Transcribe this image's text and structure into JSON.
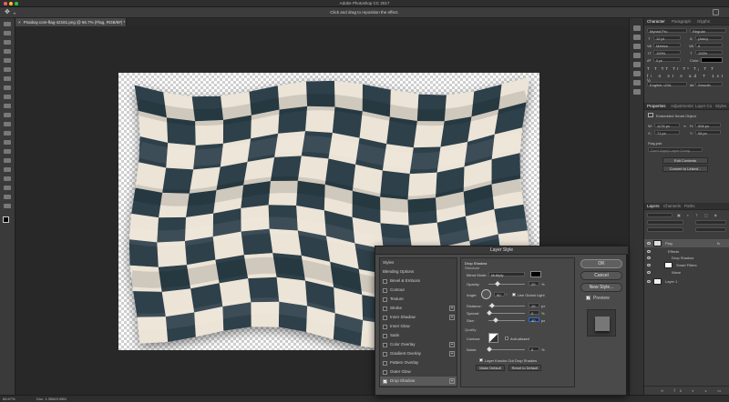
{
  "app": {
    "title": "Adobe Photoshop CC 2017"
  },
  "options_bar": {
    "hint": "Click and drag to reposition the effect."
  },
  "document": {
    "tab_label": "Pixabay.com-flag-42181.png @ 66.7% (Flag, RGB/8#) *",
    "tab_close": "×"
  },
  "status": {
    "zoom": "66.67%",
    "doc_info": "Doc: 1.35M/4.95M"
  },
  "colors": {
    "accent": "#2d6fd6",
    "flag_dark": "#2d3f4a",
    "flag_light": "#ece4d6"
  },
  "character_panel": {
    "tabs": [
      "Character",
      "Paragraph",
      "Glyphs"
    ],
    "font": "Myriad Pro",
    "font_style": "Regular",
    "size": "12 pt",
    "leading": "(Auto)",
    "kerning": "Metrics",
    "tracking": "0",
    "vscale": "100%",
    "hscale": "100%",
    "baseline": "0 pt",
    "color_label": "Color:",
    "language": "English: USA",
    "aa_label": "aa",
    "aa_value": "Smooth"
  },
  "properties_panel": {
    "tabs": [
      "Properties",
      "Adjustments",
      "Layer Co",
      "Styles"
    ],
    "title": "Embedded Smart Object",
    "w_label": "W:",
    "w": "1176 px",
    "h_label": "H:",
    "h": "906 px",
    "x_label": "X:",
    "x": "71 px",
    "y_label": "Y:",
    "y": "58 px",
    "path_label": "Flag.psb",
    "comp_placeholder": "Don't Apply Layer Comp",
    "edit_button": "Edit Contents",
    "convert_button": "Convert to Linked..."
  },
  "layers_panel": {
    "tabs": [
      "Layers",
      "Channels",
      "Paths"
    ],
    "layers": [
      {
        "name": "Flag",
        "fx": "fx"
      },
      {
        "name": "Effects"
      },
      {
        "name": "Drop Shadow"
      },
      {
        "name": "Smart Filters"
      },
      {
        "name": "Wave"
      },
      {
        "name": "Layer 1"
      }
    ]
  },
  "layer_style": {
    "title": "Layer Style",
    "styles_header": "Styles",
    "items": [
      {
        "label": "Blending Options",
        "check": false,
        "plus": false
      },
      {
        "label": "Bevel & Emboss",
        "check": true,
        "plus": false
      },
      {
        "label": "Contour",
        "check": true,
        "plus": false
      },
      {
        "label": "Texture",
        "check": true,
        "plus": false
      },
      {
        "label": "Stroke",
        "check": true,
        "plus": true
      },
      {
        "label": "Inner Shadow",
        "check": true,
        "plus": true
      },
      {
        "label": "Inner Glow",
        "check": true,
        "plus": false
      },
      {
        "label": "Satin",
        "check": true,
        "plus": false
      },
      {
        "label": "Color Overlay",
        "check": true,
        "plus": true
      },
      {
        "label": "Gradient Overlay",
        "check": true,
        "plus": true
      },
      {
        "label": "Pattern Overlay",
        "check": true,
        "plus": false
      },
      {
        "label": "Outer Glow",
        "check": true,
        "plus": false
      },
      {
        "label": "Drop Shadow",
        "check": true,
        "plus": true
      }
    ],
    "footer_fx": "fx",
    "drop_shadow": {
      "header": "Drop Shadow",
      "structure": "Structure",
      "blend_mode_label": "Blend Mode:",
      "blend_mode": "Multiply",
      "opacity_label": "Opacity:",
      "opacity": "20",
      "angle_label": "Angle:",
      "angle": "90",
      "global_light": "Use Global Light",
      "distance_label": "Distance:",
      "distance": "10",
      "spread_label": "Spread:",
      "spread": "0",
      "size_label": "Size:",
      "size": "40",
      "quality": "Quality",
      "contour_label": "Contour:",
      "anti_aliased": "Anti-aliased",
      "noise_label": "Noise:",
      "noise": "0",
      "knocks_out": "Layer Knocks Out Drop Shadow",
      "make_default": "Make Default",
      "reset_default": "Reset to Default",
      "unit_px": "px",
      "unit_pct": "%",
      "unit_deg": "°"
    },
    "buttons": {
      "ok": "OK",
      "cancel": "Cancel",
      "new_style": "New Style...",
      "preview": "Preview"
    }
  }
}
